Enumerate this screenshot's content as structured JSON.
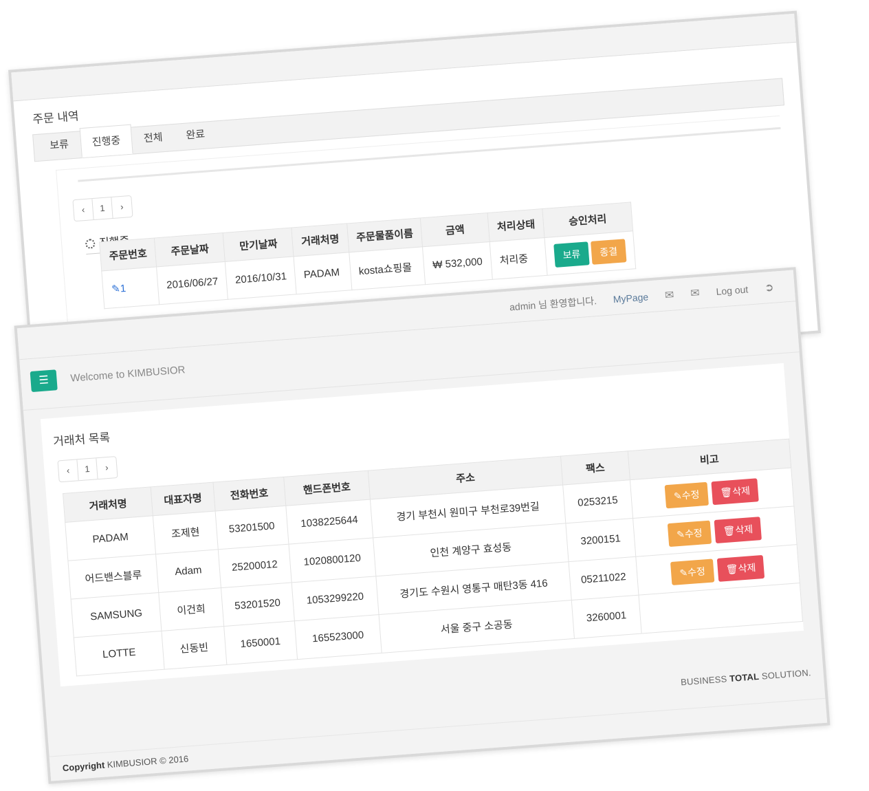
{
  "orders": {
    "title": "주문 내역",
    "tabs": [
      "보류",
      "진행중",
      "전체",
      "완료"
    ],
    "active_tab": "진행중",
    "pager": {
      "prev": "‹",
      "page": "1",
      "next": "›"
    },
    "section_heading": "진행중",
    "columns": [
      "주문번호",
      "주문날짜",
      "만기날짜",
      "거래처명",
      "주문물품이름",
      "금액",
      "처리상태",
      "승인처리"
    ],
    "rows": [
      {
        "id": "1",
        "order_date": "2016/06/27",
        "due_date": "2016/10/31",
        "client": "PADAM",
        "item": "kosta쇼핑몰",
        "amount": "₩ 532,000",
        "status": "처리중",
        "hold_label": "보류",
        "close_label": "종결"
      }
    ]
  },
  "topbar": {
    "user": "admin 님 환영합니다.",
    "mypage": "MyPage",
    "logout": "Log out"
  },
  "header": {
    "welcome": "Welcome to KIMBUSIOR"
  },
  "clients": {
    "title": "거래처 목록",
    "pager": {
      "prev": "‹",
      "page": "1",
      "next": "›"
    },
    "columns": [
      "거래처명",
      "대표자명",
      "전화번호",
      "핸드폰번호",
      "주소",
      "팩스",
      "비고"
    ],
    "edit_label": "수정",
    "delete_label": "삭제",
    "rows": [
      {
        "name": "PADAM",
        "ceo": "조제현",
        "phone": "53201500",
        "mobile": "1038225644",
        "address": "경기 부천시 원미구 부천로39번길",
        "fax": "0253215"
      },
      {
        "name": "어드밴스블루",
        "ceo": "Adam",
        "phone": "25200012",
        "mobile": "1020800120",
        "address": "인천 계양구 효성동",
        "fax": "3200151"
      },
      {
        "name": "SAMSUNG",
        "ceo": "이건희",
        "phone": "53201520",
        "mobile": "1053299220",
        "address": "경기도 수원시 영통구 매탄3동 416",
        "fax": "05211022"
      },
      {
        "name": "LOTTE",
        "ceo": "신동빈",
        "phone": "1650001",
        "mobile": "165523000",
        "address": "서울 중구 소공동",
        "fax": "3260001"
      }
    ]
  },
  "tagline": {
    "pre": "BUSINESS ",
    "bold": "TOTAL",
    "post": " SOLUTION."
  },
  "footer": {
    "bold": "Copyright",
    "text": " KIMBUSIOR © 2016"
  },
  "colors": {
    "green": "#1aaa8c",
    "orange": "#f2a64a",
    "red": "#e8505b"
  }
}
